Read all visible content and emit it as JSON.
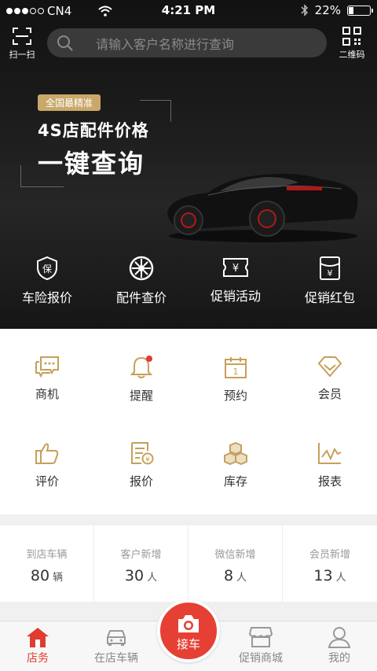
{
  "status_bar": {
    "carrier": "CN4",
    "time": "4:21 PM",
    "battery": "22%",
    "battery_level": 0.22
  },
  "header": {
    "scan_label": "扫一扫",
    "search_placeholder": "请输入客户名称进行查询",
    "qr_label": "二维码"
  },
  "banner": {
    "badge": "全国最精准",
    "title_line1": "4S店配件价格",
    "title_line2": "一键查询"
  },
  "quick_actions": [
    {
      "label": "车险报价",
      "icon": "shield-icon"
    },
    {
      "label": "配件查价",
      "icon": "wheel-icon"
    },
    {
      "label": "促销活动",
      "icon": "coupon-icon"
    },
    {
      "label": "促销红包",
      "icon": "red-packet-icon"
    }
  ],
  "grid": [
    {
      "label": "商机",
      "icon": "chat-icon"
    },
    {
      "label": "提醒",
      "icon": "bell-icon",
      "dot": true
    },
    {
      "label": "预约",
      "icon": "calendar-icon"
    },
    {
      "label": "会员",
      "icon": "diamond-icon"
    },
    {
      "label": "评价",
      "icon": "thumbs-up-icon"
    },
    {
      "label": "报价",
      "icon": "quote-icon"
    },
    {
      "label": "库存",
      "icon": "boxes-icon"
    },
    {
      "label": "报表",
      "icon": "chart-icon"
    }
  ],
  "stats": [
    {
      "label": "到店车辆",
      "value": "80",
      "unit": "辆"
    },
    {
      "label": "客户新增",
      "value": "30",
      "unit": "人"
    },
    {
      "label": "微信新增",
      "value": "8",
      "unit": "人"
    },
    {
      "label": "会员新增",
      "value": "13",
      "unit": "人"
    }
  ],
  "tabbar": {
    "tabs": [
      {
        "label": "店务",
        "icon": "store-icon",
        "active": true
      },
      {
        "label": "在店车辆",
        "icon": "car-icon"
      },
      {
        "label": "促销商城",
        "icon": "shop-icon"
      },
      {
        "label": "我的",
        "icon": "user-icon"
      }
    ],
    "center_label": "接车"
  },
  "colors": {
    "accent_gold": "#c9a86a",
    "brand_red": "#e64035",
    "icon_gold": "#c6a05a"
  }
}
